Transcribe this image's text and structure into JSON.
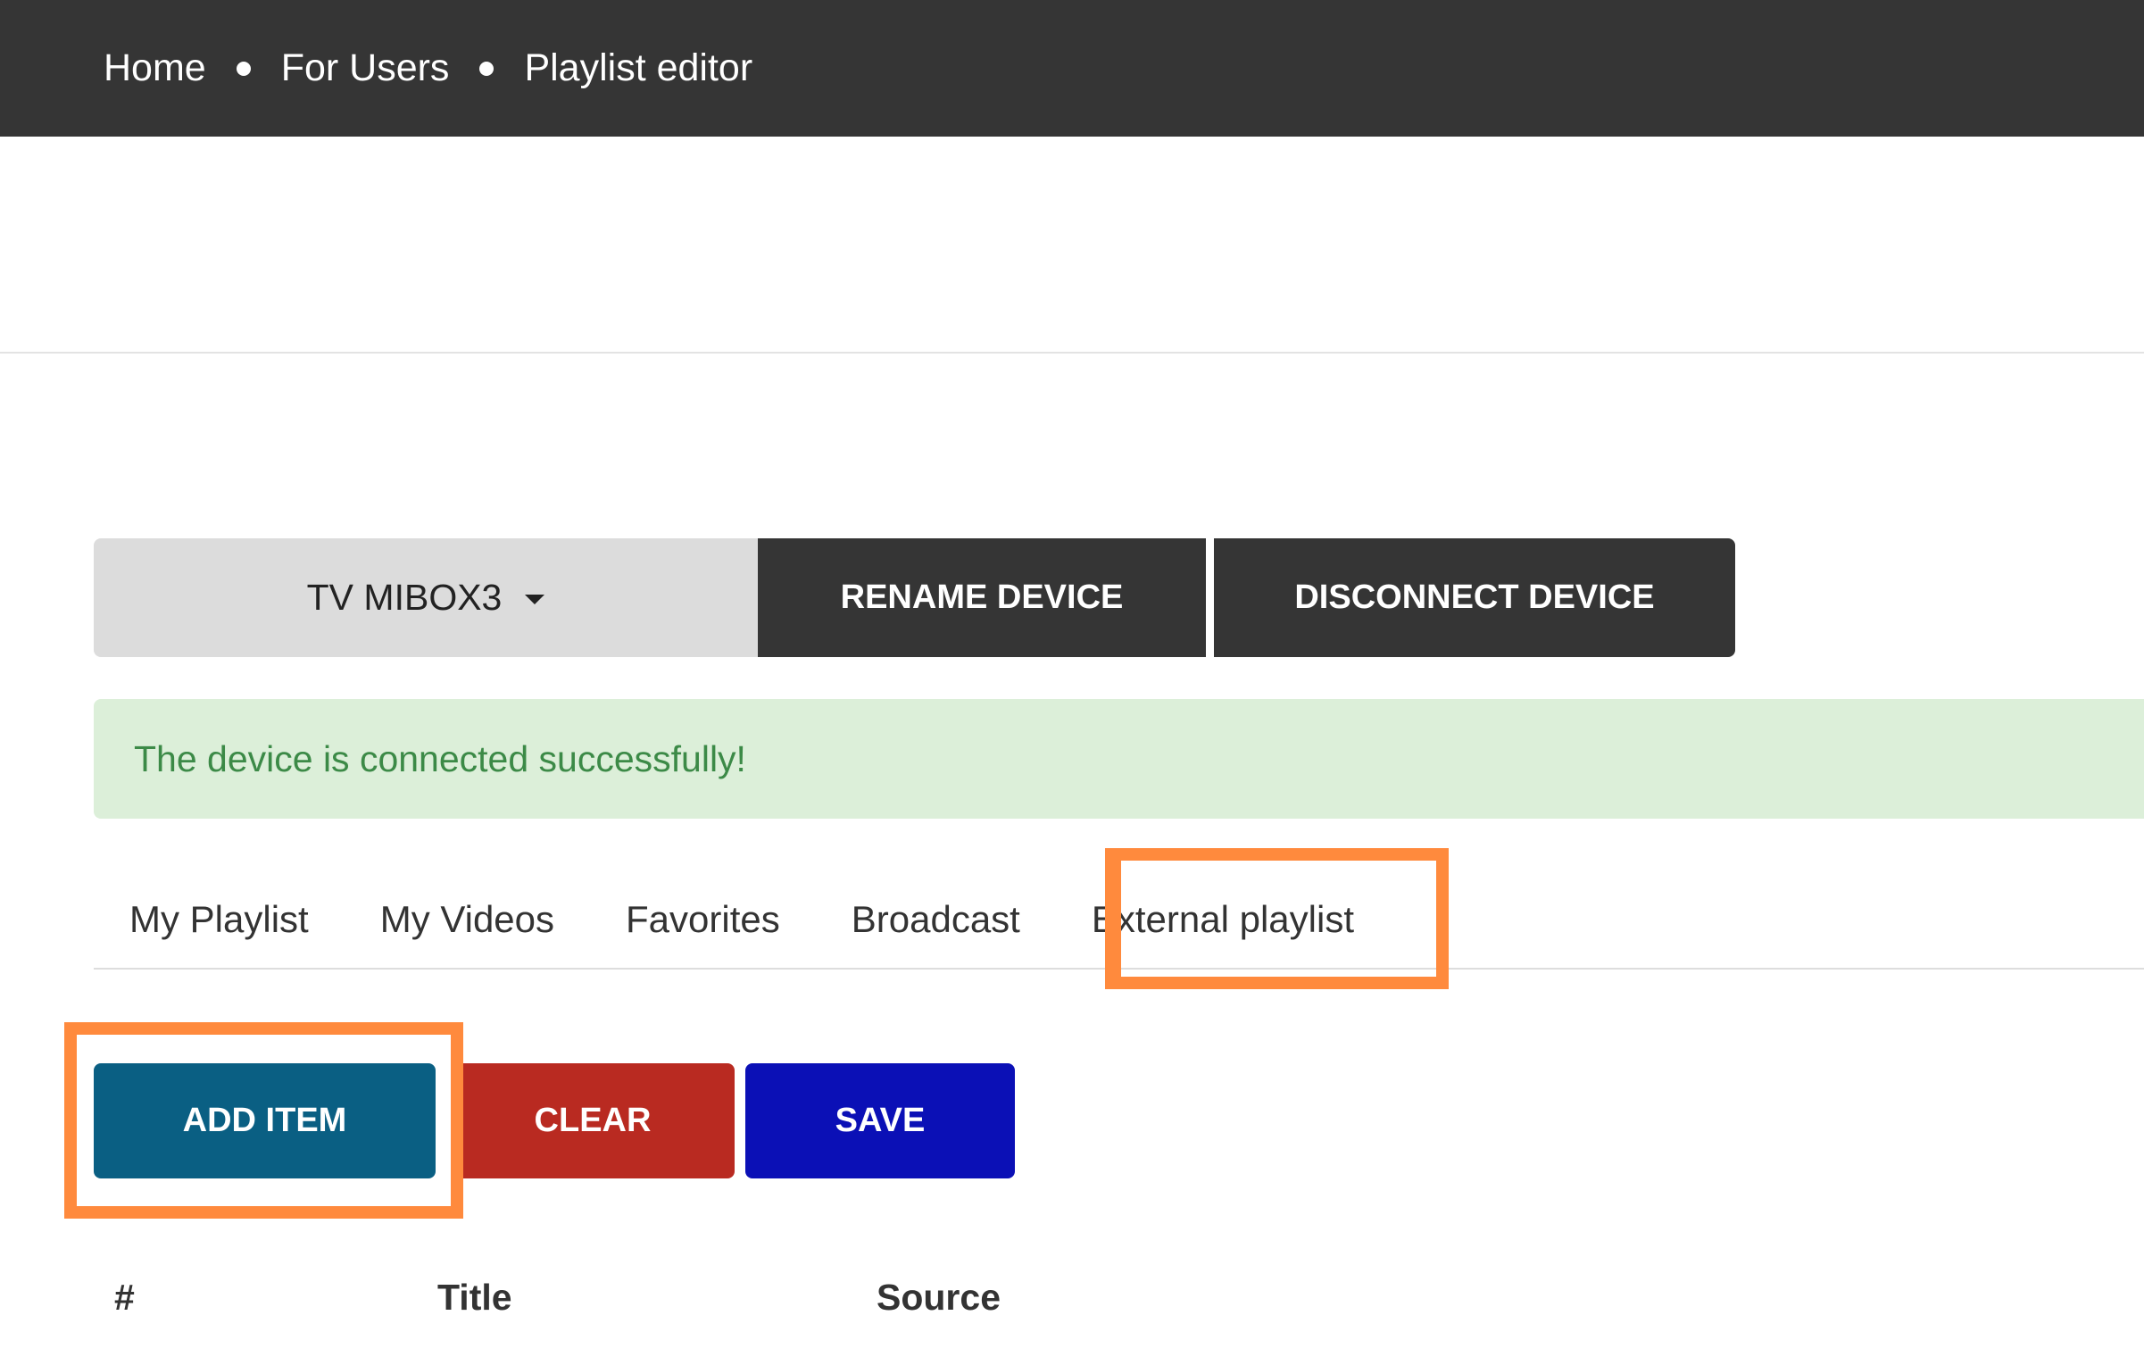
{
  "breadcrumb": {
    "items": [
      "Home",
      "For Users",
      "Playlist editor"
    ]
  },
  "device_bar": {
    "device_name": "TV MIBOX3",
    "rename_label": "RENAME DEVICE",
    "disconnect_label": "DISCONNECT DEVICE"
  },
  "alert": {
    "message": "The device is connected successfully!"
  },
  "tabs": [
    "My Playlist",
    "My Videos",
    "Favorites",
    "Broadcast",
    "External playlist"
  ],
  "actions": {
    "add_label": "ADD ITEM",
    "clear_label": "CLEAR",
    "save_label": "SAVE"
  },
  "table": {
    "headers": [
      "#",
      "Title",
      "Source"
    ]
  },
  "colors": {
    "topbar": "#353535",
    "success_bg": "#dcefd9",
    "success_text": "#3c8a47",
    "add_button": "#0a5f83",
    "clear_button": "#b92a21",
    "save_button": "#0b10b6",
    "highlight": "#ff8a3d"
  }
}
